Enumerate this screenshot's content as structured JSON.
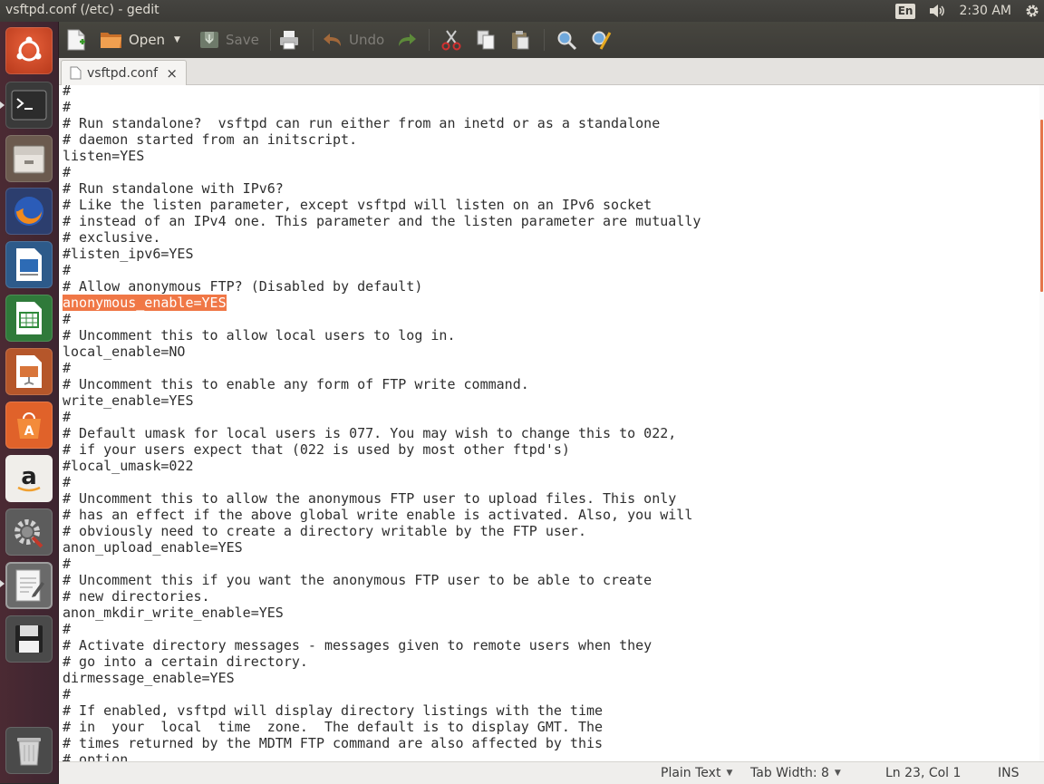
{
  "window": {
    "title": "vsftpd.conf (/etc) - gedit"
  },
  "panel": {
    "keyboard_layout": "En",
    "clock": "2:30 AM",
    "icons": [
      "volume-icon",
      "gear-icon"
    ]
  },
  "launcher": {
    "items": [
      "ubuntu-logo",
      "terminal",
      "files",
      "firefox",
      "libreoffice-writer",
      "libreoffice-calc",
      "libreoffice-impress",
      "software-center",
      "amazon",
      "system-settings",
      "text-editor",
      "save-disk",
      "trash"
    ]
  },
  "toolbar": {
    "new_label": "",
    "open_label": "Open",
    "save_label": "Save",
    "undo_label": "Undo"
  },
  "tab": {
    "name": "vsftpd.conf",
    "close": "×"
  },
  "editor": {
    "highlight_line_index": 13,
    "lines": [
      "#",
      "#",
      "# Run standalone?  vsftpd can run either from an inetd or as a standalone",
      "# daemon started from an initscript.",
      "listen=YES",
      "#",
      "# Run standalone with IPv6?",
      "# Like the listen parameter, except vsftpd will listen on an IPv6 socket",
      "# instead of an IPv4 one. This parameter and the listen parameter are mutually",
      "# exclusive.",
      "#listen_ipv6=YES",
      "#",
      "# Allow anonymous FTP? (Disabled by default)",
      "anonymous_enable=YES",
      "#",
      "# Uncomment this to allow local users to log in.",
      "local_enable=NO",
      "#",
      "# Uncomment this to enable any form of FTP write command.",
      "write_enable=YES",
      "#",
      "# Default umask for local users is 077. You may wish to change this to 022,",
      "# if your users expect that (022 is used by most other ftpd's)",
      "#local_umask=022",
      "#",
      "# Uncomment this to allow the anonymous FTP user to upload files. This only",
      "# has an effect if the above global write enable is activated. Also, you will",
      "# obviously need to create a directory writable by the FTP user.",
      "anon_upload_enable=YES",
      "#",
      "# Uncomment this if you want the anonymous FTP user to be able to create",
      "# new directories.",
      "anon_mkdir_write_enable=YES",
      "#",
      "# Activate directory messages - messages given to remote users when they",
      "# go into a certain directory.",
      "dirmessage_enable=YES",
      "#",
      "# If enabled, vsftpd will display directory listings with the time",
      "# in  your  local  time  zone.  The default is to display GMT. The",
      "# times returned by the MDTM FTP command are also affected by this",
      "# option"
    ]
  },
  "statusbar": {
    "language": "Plain Text",
    "tab_width": "Tab Width: 8",
    "position": "Ln 23, Col 1",
    "mode": "INS"
  },
  "colors": {
    "accent": "#f07746",
    "launcher_bg": "#4b2a33",
    "panel_bg": "#3c3b37"
  }
}
